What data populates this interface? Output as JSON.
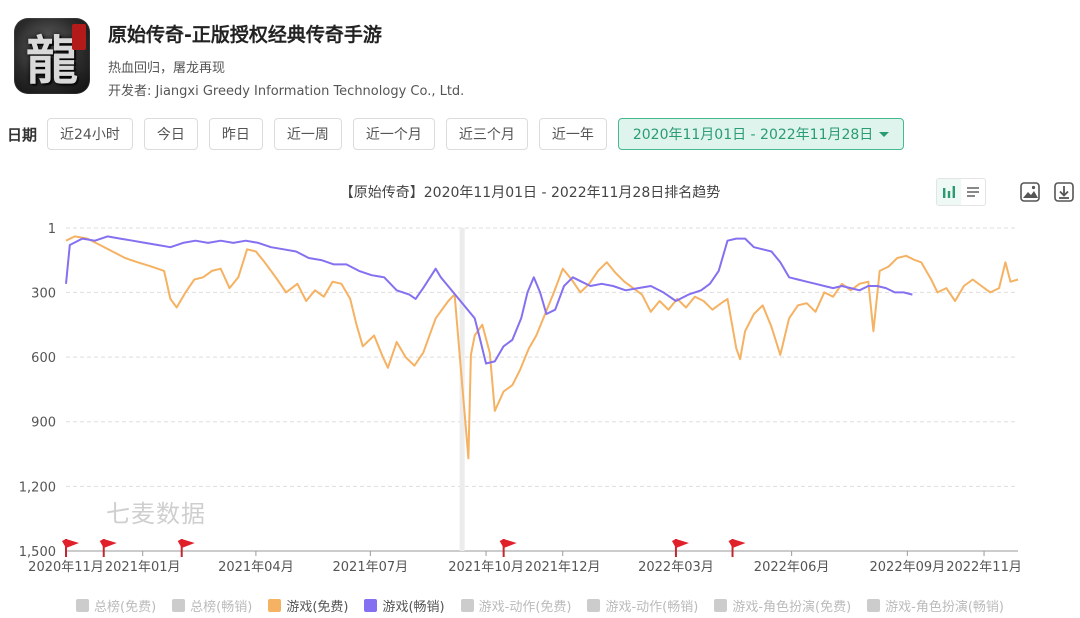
{
  "app": {
    "title": "原始传奇-正版授权经典传奇手游",
    "subtitle": "热血回归，屠龙再现",
    "developer": "开发者: Jiangxi Greedy Information Technology Co., Ltd.",
    "icon_glyph": "龍"
  },
  "date_filter": {
    "label": "日期",
    "options": [
      "近24小时",
      "今日",
      "昨日",
      "近一周",
      "近一个月",
      "近三个月",
      "近一年"
    ],
    "selected_range": "2020年11月01日 - 2022年11月28日"
  },
  "toolbar": {
    "icons": [
      "bar-chart-icon",
      "list-icon",
      "image-download-icon",
      "download-icon"
    ]
  },
  "watermark": "七麦数据",
  "chart_data": {
    "type": "line",
    "title": "【原始传奇】2020年11月01日 - 2022年11月28日排名趋势",
    "y_inverted": true,
    "ylim": [
      1,
      1500
    ],
    "y_ticks": [
      "1",
      "300",
      "600",
      "900",
      "1,200",
      "1,500"
    ],
    "y_tick_values": [
      1,
      300,
      600,
      900,
      1200,
      1500
    ],
    "x_range": [
      "2020-11-01",
      "2022-11-28"
    ],
    "x_ticks": [
      {
        "label": "2020年11月",
        "date": "2020-11-01"
      },
      {
        "label": "2021年01月",
        "date": "2021-01-01"
      },
      {
        "label": "2021年04月",
        "date": "2021-04-01"
      },
      {
        "label": "2021年07月",
        "date": "2021-07-01"
      },
      {
        "label": "2021年10月",
        "date": "2021-10-01"
      },
      {
        "label": "2021年12月",
        "date": "2021-12-01"
      },
      {
        "label": "2022年03月",
        "date": "2022-03-01"
      },
      {
        "label": "2022年06月",
        "date": "2022-06-01"
      },
      {
        "label": "2022年09月",
        "date": "2022-09-01"
      },
      {
        "label": "2022年11月",
        "date": "2022-11-01"
      }
    ],
    "grid": true,
    "flags": [
      "2020-11-01",
      "2020-12-01",
      "2021-02-01",
      "2021-10-15",
      "2022-03-01",
      "2022-04-15"
    ],
    "missing_band": [
      "2021-09-10",
      "2021-09-14"
    ],
    "series": [
      {
        "name": "游戏(免费)",
        "color": "#f5b263",
        "points": [
          [
            "2020-11-01",
            60
          ],
          [
            "2020-11-08",
            40
          ],
          [
            "2020-11-18",
            50
          ],
          [
            "2020-11-28",
            80
          ],
          [
            "2020-12-08",
            110
          ],
          [
            "2020-12-18",
            140
          ],
          [
            "2020-12-28",
            160
          ],
          [
            "2021-01-08",
            180
          ],
          [
            "2021-01-18",
            200
          ],
          [
            "2021-01-23",
            330
          ],
          [
            "2021-01-28",
            370
          ],
          [
            "2021-02-04",
            300
          ],
          [
            "2021-02-11",
            240
          ],
          [
            "2021-02-18",
            230
          ],
          [
            "2021-02-25",
            200
          ],
          [
            "2021-03-04",
            190
          ],
          [
            "2021-03-11",
            280
          ],
          [
            "2021-03-18",
            230
          ],
          [
            "2021-03-25",
            100
          ],
          [
            "2021-04-01",
            110
          ],
          [
            "2021-04-08",
            160
          ],
          [
            "2021-04-18",
            240
          ],
          [
            "2021-04-25",
            300
          ],
          [
            "2021-05-04",
            260
          ],
          [
            "2021-05-11",
            340
          ],
          [
            "2021-05-18",
            290
          ],
          [
            "2021-05-25",
            320
          ],
          [
            "2021-06-01",
            250
          ],
          [
            "2021-06-08",
            260
          ],
          [
            "2021-06-15",
            330
          ],
          [
            "2021-06-20",
            450
          ],
          [
            "2021-06-25",
            550
          ],
          [
            "2021-07-04",
            500
          ],
          [
            "2021-07-11",
            600
          ],
          [
            "2021-07-15",
            650
          ],
          [
            "2021-07-22",
            530
          ],
          [
            "2021-07-29",
            600
          ],
          [
            "2021-08-05",
            640
          ],
          [
            "2021-08-12",
            580
          ],
          [
            "2021-08-22",
            420
          ],
          [
            "2021-09-01",
            340
          ],
          [
            "2021-09-06",
            310
          ],
          [
            "2021-09-17",
            1070
          ],
          [
            "2021-09-19",
            590
          ],
          [
            "2021-09-22",
            500
          ],
          [
            "2021-09-28",
            450
          ],
          [
            "2021-10-04",
            580
          ],
          [
            "2021-10-08",
            850
          ],
          [
            "2021-10-15",
            760
          ],
          [
            "2021-10-22",
            730
          ],
          [
            "2021-10-28",
            660
          ],
          [
            "2021-11-04",
            560
          ],
          [
            "2021-11-10",
            500
          ],
          [
            "2021-11-17",
            400
          ],
          [
            "2021-11-24",
            300
          ],
          [
            "2021-12-01",
            190
          ],
          [
            "2021-12-08",
            240
          ],
          [
            "2021-12-15",
            300
          ],
          [
            "2021-12-22",
            260
          ],
          [
            "2021-12-29",
            200
          ],
          [
            "2022-01-05",
            160
          ],
          [
            "2022-01-12",
            210
          ],
          [
            "2022-01-19",
            250
          ],
          [
            "2022-01-26",
            280
          ],
          [
            "2022-02-02",
            310
          ],
          [
            "2022-02-09",
            390
          ],
          [
            "2022-02-16",
            340
          ],
          [
            "2022-02-23",
            380
          ],
          [
            "2022-03-02",
            330
          ],
          [
            "2022-03-09",
            370
          ],
          [
            "2022-03-16",
            320
          ],
          [
            "2022-03-23",
            340
          ],
          [
            "2022-03-30",
            380
          ],
          [
            "2022-04-06",
            350
          ],
          [
            "2022-04-11",
            330
          ],
          [
            "2022-04-18",
            560
          ],
          [
            "2022-04-21",
            610
          ],
          [
            "2022-04-25",
            480
          ],
          [
            "2022-05-02",
            400
          ],
          [
            "2022-05-09",
            360
          ],
          [
            "2022-05-16",
            460
          ],
          [
            "2022-05-23",
            590
          ],
          [
            "2022-05-30",
            420
          ],
          [
            "2022-06-06",
            360
          ],
          [
            "2022-06-13",
            350
          ],
          [
            "2022-06-20",
            390
          ],
          [
            "2022-06-27",
            300
          ],
          [
            "2022-07-04",
            320
          ],
          [
            "2022-07-11",
            260
          ],
          [
            "2022-07-18",
            290
          ],
          [
            "2022-07-25",
            260
          ],
          [
            "2022-08-01",
            250
          ],
          [
            "2022-08-05",
            480
          ],
          [
            "2022-08-10",
            200
          ],
          [
            "2022-08-17",
            180
          ],
          [
            "2022-08-24",
            140
          ],
          [
            "2022-08-31",
            130
          ],
          [
            "2022-09-07",
            150
          ],
          [
            "2022-09-12",
            160
          ],
          [
            "2022-09-20",
            240
          ],
          [
            "2022-09-25",
            300
          ],
          [
            "2022-10-02",
            280
          ],
          [
            "2022-10-09",
            340
          ],
          [
            "2022-10-16",
            270
          ],
          [
            "2022-10-23",
            240
          ],
          [
            "2022-10-30",
            270
          ],
          [
            "2022-11-06",
            300
          ],
          [
            "2022-11-13",
            280
          ],
          [
            "2022-11-18",
            160
          ],
          [
            "2022-11-22",
            250
          ],
          [
            "2022-11-28",
            240
          ]
        ]
      },
      {
        "name": "游戏(畅销)",
        "color": "#8470f0",
        "points": [
          [
            "2020-11-01",
            260
          ],
          [
            "2020-11-04",
            80
          ],
          [
            "2020-11-14",
            50
          ],
          [
            "2020-11-24",
            60
          ],
          [
            "2020-12-04",
            40
          ],
          [
            "2020-12-14",
            50
          ],
          [
            "2020-12-24",
            60
          ],
          [
            "2021-01-03",
            70
          ],
          [
            "2021-01-13",
            80
          ],
          [
            "2021-01-23",
            90
          ],
          [
            "2021-02-02",
            70
          ],
          [
            "2021-02-12",
            60
          ],
          [
            "2021-02-22",
            70
          ],
          [
            "2021-03-04",
            60
          ],
          [
            "2021-03-14",
            70
          ],
          [
            "2021-03-24",
            60
          ],
          [
            "2021-04-03",
            70
          ],
          [
            "2021-04-13",
            90
          ],
          [
            "2021-04-23",
            100
          ],
          [
            "2021-05-03",
            110
          ],
          [
            "2021-05-13",
            140
          ],
          [
            "2021-05-23",
            150
          ],
          [
            "2021-06-02",
            170
          ],
          [
            "2021-06-12",
            170
          ],
          [
            "2021-06-22",
            200
          ],
          [
            "2021-07-02",
            220
          ],
          [
            "2021-07-12",
            230
          ],
          [
            "2021-07-22",
            290
          ],
          [
            "2021-08-01",
            310
          ],
          [
            "2021-08-06",
            330
          ],
          [
            "2021-08-12",
            280
          ],
          [
            "2021-08-22",
            190
          ],
          [
            "2021-08-26",
            230
          ],
          [
            "2021-09-22",
            420
          ],
          [
            "2021-09-26",
            510
          ],
          [
            "2021-10-01",
            630
          ],
          [
            "2021-10-08",
            620
          ],
          [
            "2021-10-15",
            550
          ],
          [
            "2021-10-22",
            520
          ],
          [
            "2021-10-29",
            420
          ],
          [
            "2021-11-03",
            300
          ],
          [
            "2021-11-08",
            230
          ],
          [
            "2021-11-13",
            300
          ],
          [
            "2021-11-18",
            400
          ],
          [
            "2021-11-25",
            380
          ],
          [
            "2021-12-02",
            270
          ],
          [
            "2021-12-09",
            230
          ],
          [
            "2021-12-16",
            250
          ],
          [
            "2021-12-23",
            270
          ],
          [
            "2022-01-01",
            260
          ],
          [
            "2022-01-10",
            270
          ],
          [
            "2022-01-20",
            290
          ],
          [
            "2022-01-30",
            280
          ],
          [
            "2022-02-09",
            270
          ],
          [
            "2022-02-19",
            300
          ],
          [
            "2022-03-01",
            340
          ],
          [
            "2022-03-11",
            310
          ],
          [
            "2022-03-21",
            290
          ],
          [
            "2022-03-28",
            260
          ],
          [
            "2022-04-04",
            200
          ],
          [
            "2022-04-11",
            60
          ],
          [
            "2022-04-18",
            50
          ],
          [
            "2022-04-25",
            50
          ],
          [
            "2022-05-02",
            90
          ],
          [
            "2022-05-09",
            100
          ],
          [
            "2022-05-16",
            110
          ],
          [
            "2022-05-23",
            160
          ],
          [
            "2022-05-30",
            230
          ],
          [
            "2022-06-06",
            240
          ],
          [
            "2022-06-13",
            250
          ],
          [
            "2022-06-20",
            260
          ],
          [
            "2022-06-27",
            270
          ],
          [
            "2022-07-04",
            280
          ],
          [
            "2022-07-11",
            270
          ],
          [
            "2022-07-18",
            280
          ],
          [
            "2022-07-25",
            290
          ],
          [
            "2022-08-01",
            270
          ],
          [
            "2022-08-08",
            270
          ],
          [
            "2022-08-15",
            280
          ],
          [
            "2022-08-22",
            300
          ],
          [
            "2022-08-29",
            300
          ],
          [
            "2022-09-05",
            310
          ]
        ]
      }
    ],
    "legend": {
      "placement": "bottom",
      "items": [
        {
          "name": "总榜(免费)",
          "color": "#cccccc",
          "active": false
        },
        {
          "name": "总榜(畅销)",
          "color": "#cccccc",
          "active": false
        },
        {
          "name": "游戏(免费)",
          "color": "#f5b263",
          "active": true
        },
        {
          "name": "游戏(畅销)",
          "color": "#8470f0",
          "active": true
        },
        {
          "name": "游戏-动作(免费)",
          "color": "#cccccc",
          "active": false
        },
        {
          "name": "游戏-动作(畅销)",
          "color": "#cccccc",
          "active": false
        },
        {
          "name": "游戏-角色扮演(免费)",
          "color": "#cccccc",
          "active": false
        },
        {
          "name": "游戏-角色扮演(畅销)",
          "color": "#cccccc",
          "active": false
        }
      ]
    }
  }
}
